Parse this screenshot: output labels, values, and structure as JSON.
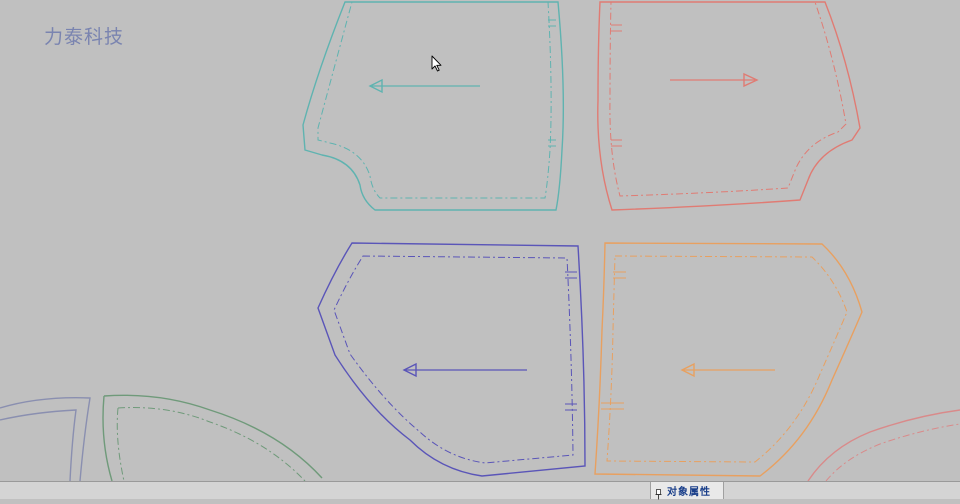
{
  "watermark": {
    "text": "力泰科技"
  },
  "statusbar": {
    "object_properties_label": "对象属性"
  },
  "colors": {
    "background": "#c0c0c0",
    "teal_piece": "#5fb3b0",
    "red_piece": "#e07b73",
    "blue_piece": "#5a55b8",
    "orange_piece": "#e8a060",
    "gray_blue_piece": "#8a8fb0",
    "green_piece": "#6f9a7a",
    "pink_piece": "#d98a8a"
  },
  "icons": {
    "cursor": "mouse-pointer-icon",
    "object_properties": "pin-icon"
  }
}
